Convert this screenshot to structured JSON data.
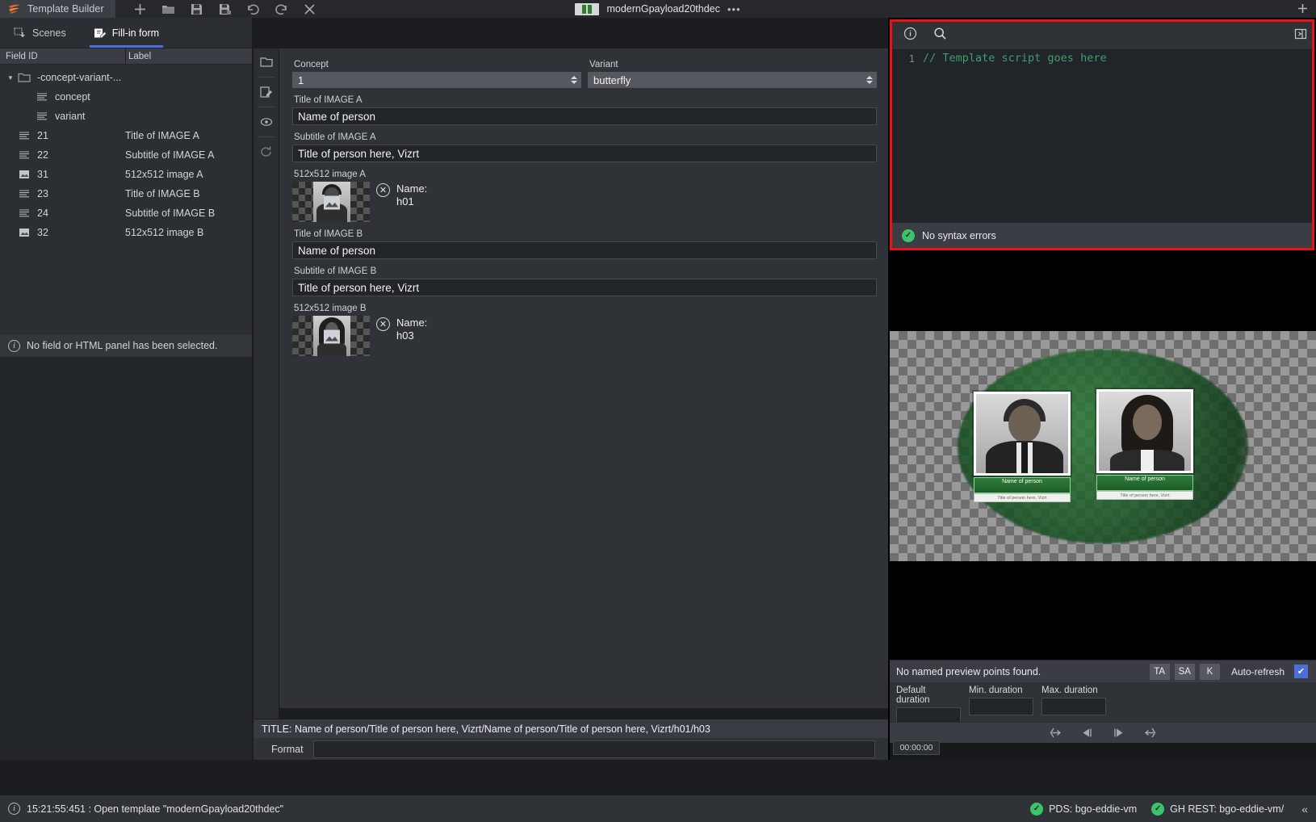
{
  "titlebar": {
    "app_name": "Template Builder",
    "logo_icon": "vizrt-flame-icon",
    "tools": [
      {
        "name": "new-icon",
        "label": "+"
      },
      {
        "name": "open-folder-icon",
        "label": "Open"
      },
      {
        "name": "save-icon",
        "label": "Save"
      },
      {
        "name": "save-as-icon",
        "label": "Save As"
      },
      {
        "name": "undo-icon",
        "label": "Undo"
      },
      {
        "name": "redo-icon",
        "label": "Redo"
      },
      {
        "name": "close-icon",
        "label": "Close"
      }
    ],
    "document_title": "modernGpayload20thdec",
    "overflow": "•••",
    "right_add": "+"
  },
  "left_panel": {
    "tabs": [
      {
        "label": "Scenes",
        "icon": "scenes-icon",
        "active": false
      },
      {
        "label": "Fill-in form",
        "icon": "fill-in-form-icon",
        "active": true
      }
    ],
    "tree_header": {
      "field_id": "Field ID",
      "label": "Label"
    },
    "tree_rows": [
      {
        "id": "-concept-variant-...",
        "label": "",
        "icon": "folder-icon",
        "indent": 0,
        "expanded": true
      },
      {
        "id": "concept",
        "label": "",
        "icon": "text-field-icon",
        "indent": 2
      },
      {
        "id": "variant",
        "label": "",
        "icon": "text-field-icon",
        "indent": 2
      },
      {
        "id": "21",
        "label": "Title of IMAGE A",
        "icon": "text-field-icon",
        "indent": 1
      },
      {
        "id": "22",
        "label": "Subtitle of IMAGE A",
        "icon": "text-field-icon",
        "indent": 1
      },
      {
        "id": "31",
        "label": "512x512 image A",
        "icon": "image-field-icon",
        "indent": 1
      },
      {
        "id": "23",
        "label": "Title of IMAGE B",
        "icon": "text-field-icon",
        "indent": 1
      },
      {
        "id": "24",
        "label": "Subtitle of IMAGE B",
        "icon": "text-field-icon",
        "indent": 1
      },
      {
        "id": "32",
        "label": "512x512 image B",
        "icon": "image-field-icon",
        "indent": 1
      }
    ],
    "info_message": "No field or HTML panel has been selected."
  },
  "rail": {
    "buttons": [
      {
        "name": "folder-tool-icon"
      },
      {
        "name": "edit-tool-icon"
      },
      {
        "name": "preview-eye-tool-icon"
      },
      {
        "name": "refresh-tool-icon"
      }
    ]
  },
  "form": {
    "concept": {
      "label": "Concept",
      "value": "1"
    },
    "variant": {
      "label": "Variant",
      "value": "butterfly"
    },
    "fields": [
      {
        "label": "Title of IMAGE A",
        "value": "Name of person",
        "type": "text"
      },
      {
        "label": "Subtitle of IMAGE A",
        "value": "Title of person here, Vizrt",
        "type": "text"
      },
      {
        "label": "512x512 image A",
        "type": "image",
        "name_label": "Name:",
        "name_value": "h01"
      },
      {
        "label": "Title of IMAGE B",
        "value": "Name of person",
        "type": "text"
      },
      {
        "label": "Subtitle of IMAGE B",
        "value": "Title of person here, Vizrt",
        "type": "text"
      },
      {
        "label": "512x512 image B",
        "type": "image",
        "name_label": "Name:",
        "name_value": "h03"
      }
    ],
    "title_summary": "TITLE: Name of person/Title of person here, Vizrt/Name of person/Title of person here, Vizrt/h01/h03",
    "format": {
      "label": "Format",
      "value": ""
    }
  },
  "script_panel": {
    "toolbar_icons": [
      {
        "name": "info-icon"
      },
      {
        "name": "search-icon"
      }
    ],
    "detach_icon": "detach-panel-icon",
    "line_number": "1",
    "code": "// Template script goes here",
    "status": "No syntax errors",
    "status_icon": "check-circle-icon",
    "highlight_color": "#ee1111",
    "code_color": "#3f9e6f"
  },
  "preview": {
    "cards": [
      {
        "name": "Name of person",
        "subtitle": "Title of person here, Vizrt"
      },
      {
        "name": "Name of person",
        "subtitle": "Title of person here, Vizrt"
      }
    ]
  },
  "preview_controls": {
    "message": "No named preview points found.",
    "buttons": [
      {
        "label": "TA",
        "name": "ta-button"
      },
      {
        "label": "SA",
        "name": "sa-button"
      },
      {
        "label": "K",
        "name": "k-button"
      }
    ],
    "auto_refresh": {
      "label": "Auto-refresh",
      "checked": true,
      "check_glyph": "✔",
      "color": "#4a6fd8"
    },
    "durations": [
      {
        "label": "Default duration",
        "value": ""
      },
      {
        "label": "Min. duration",
        "value": ""
      },
      {
        "label": "Max. duration",
        "value": ""
      }
    ],
    "transport": [
      {
        "name": "go-to-start-icon"
      },
      {
        "name": "step-back-icon"
      },
      {
        "name": "step-forward-icon"
      },
      {
        "name": "go-to-end-icon"
      }
    ],
    "timeline_zero": "0",
    "timecode": "00:00:00"
  },
  "statusbar": {
    "message": "15:21:55:451 : Open template \"modernGpayload20thdec\"",
    "info_icon": "info-icon",
    "connections": [
      {
        "label": "PDS: bgo-eddie-vm",
        "status": "ok"
      },
      {
        "label": "GH REST: bgo-eddie-vm/",
        "status": "ok"
      }
    ],
    "collapse_glyph": "«",
    "ok_color": "#3dc36b"
  }
}
